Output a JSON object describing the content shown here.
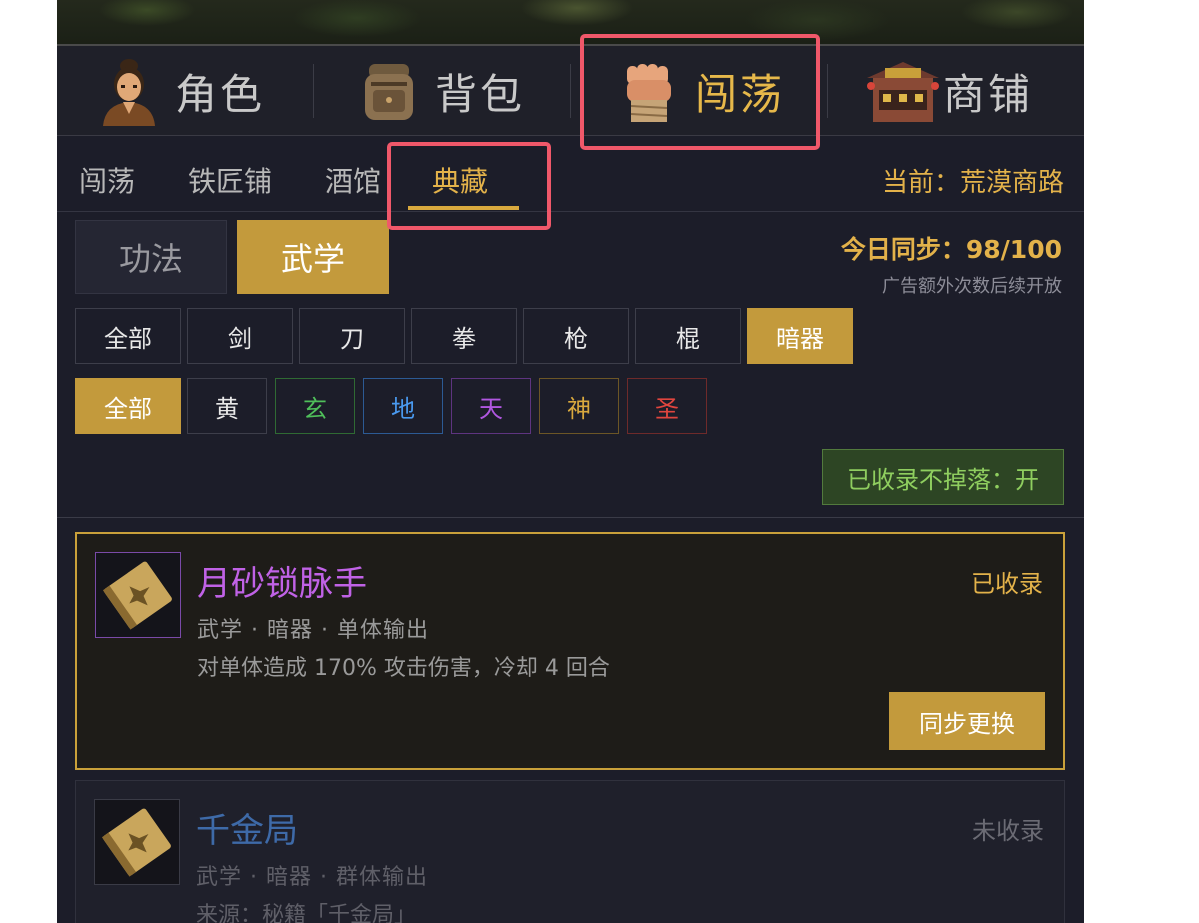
{
  "nav": {
    "items": [
      {
        "label": "角色",
        "icon": "character-portrait-icon"
      },
      {
        "label": "背包",
        "icon": "backpack-icon"
      },
      {
        "label": "闯荡",
        "icon": "fist-icon"
      },
      {
        "label": "商铺",
        "icon": "shop-building-icon"
      }
    ],
    "active": "闯荡"
  },
  "sub_tabs": {
    "items": [
      "闯荡",
      "铁匠铺",
      "酒馆",
      "典藏"
    ],
    "active": "典藏",
    "current_location": "当前：荒漠商路"
  },
  "category_tabs": {
    "items": [
      "功法",
      "武学"
    ],
    "active": "武学"
  },
  "sync": {
    "count": "今日同步：98/100",
    "note": "广告额外次数后续开放"
  },
  "weapon_filters": {
    "items": [
      "全部",
      "剑",
      "刀",
      "拳",
      "枪",
      "棍",
      "暗器"
    ],
    "active": "暗器"
  },
  "rank_filters": {
    "items": [
      {
        "label": "全部",
        "color": "#ffffff"
      },
      {
        "label": "黄",
        "color": "#e8e8e8"
      },
      {
        "label": "玄",
        "color": "#4fbf5a"
      },
      {
        "label": "地",
        "color": "#4a9af0"
      },
      {
        "label": "天",
        "color": "#b057e0"
      },
      {
        "label": "神",
        "color": "#d9a93e"
      },
      {
        "label": "圣",
        "color": "#e0453e"
      }
    ],
    "active": "全部"
  },
  "drop_toggle": "已收录不掉落：开",
  "cards": [
    {
      "title": "月砂锁脉手",
      "title_color": "#c062e6",
      "meta": "武学 · 暗器 · 单体输出",
      "desc": "对单体造成 170% 攻击伤害，冷却 4 回合",
      "status": "已收录",
      "status_color": "#e3b24a",
      "button": "同步更换",
      "icon": "martial-book-icon"
    },
    {
      "title": "千金局",
      "title_color": "#3e6aa8",
      "meta": "武学 · 暗器 · 群体输出",
      "desc": "来源：秘籍「千金局」",
      "status": "未收录",
      "status_color": "#6b6b74",
      "icon": "martial-book-icon"
    }
  ],
  "colors": {
    "accent": "#c39a3c",
    "highlight": "#f0586a",
    "background": "#1c1d29"
  }
}
